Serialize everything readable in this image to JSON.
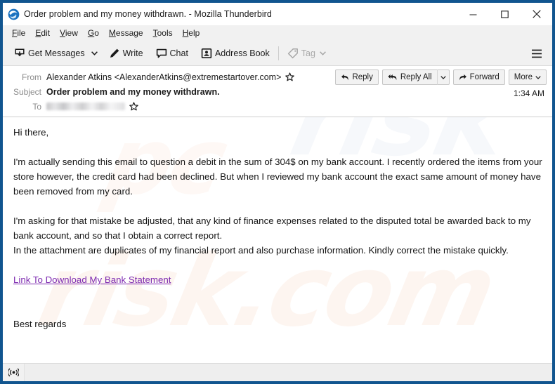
{
  "window": {
    "title": "Order problem and my money withdrawn. - Mozilla Thunderbird",
    "app_icon": "thunderbird-logo-icon",
    "border_color": "#11558f",
    "controls": {
      "minimize": "minimize-icon",
      "maximize": "maximize-icon",
      "close": "close-icon"
    }
  },
  "menu_bar": {
    "items": [
      {
        "label": "File",
        "accel": "F"
      },
      {
        "label": "Edit",
        "accel": "E"
      },
      {
        "label": "View",
        "accel": "V"
      },
      {
        "label": "Go",
        "accel": "G"
      },
      {
        "label": "Message",
        "accel": "M"
      },
      {
        "label": "Tools",
        "accel": "T"
      },
      {
        "label": "Help",
        "accel": "H"
      }
    ]
  },
  "toolbar": {
    "get_messages_label": "Get Messages",
    "get_messages_icon": "download-inbox-icon",
    "get_messages_dropdown_icon": "chevron-down-icon",
    "write_label": "Write",
    "write_icon": "pencil-icon",
    "chat_label": "Chat",
    "chat_icon": "speech-bubble-icon",
    "address_book_label": "Address Book",
    "address_book_icon": "contact-card-icon",
    "tag_label": "Tag",
    "tag_icon": "tag-icon",
    "tag_dropdown_icon": "chevron-down-icon",
    "tag_disabled": true,
    "app_menu_icon": "hamburger-menu-icon"
  },
  "message_header": {
    "from_label": "From",
    "from_value": "Alexander Atkins <AlexanderAtkins@extremestartover.com>",
    "from_star_icon": "star-icon",
    "subject_label": "Subject",
    "subject_value": "Order problem and my money withdrawn.",
    "to_label": "To",
    "to_value": "",
    "to_redacted": true,
    "to_star_icon": "star-icon",
    "timestamp": "1:34 AM",
    "actions": {
      "reply_label": "Reply",
      "reply_icon": "reply-arrow-icon",
      "reply_all_label": "Reply All",
      "reply_all_icon": "reply-all-arrow-icon",
      "reply_all_dropdown_icon": "chevron-down-icon",
      "forward_label": "Forward",
      "forward_icon": "forward-arrow-icon",
      "more_label": "More",
      "more_dropdown_icon": "chevron-down-icon"
    }
  },
  "message_body": {
    "greeting": "Hi there,",
    "paragraph_1": "I'm actually sending this email to question a debit in the sum of 304$ on my bank account. I recently ordered the items from your store however, the credit card had been declined. But when I reviewed my bank account the exact same amount of money have been removed from my card.",
    "paragraph_2": "I'm asking for that mistake be adjusted, that any kind of finance expenses related to the disputed total be awarded back to my bank account, and so that I obtain a correct report.",
    "paragraph_3": "In the attachment are duplicates of my financial report and also purchase information. Kindly correct the mistake quickly.",
    "link_text": "Link To Download My Bank Statement",
    "link_color": "#7d2ab0",
    "signoff": "Best regards"
  },
  "status_bar": {
    "icon": "broadcast-antenna-icon",
    "text": ""
  },
  "watermark": {
    "text_a": "risk",
    "text_b": "risk.com",
    "text_c": "pc"
  }
}
